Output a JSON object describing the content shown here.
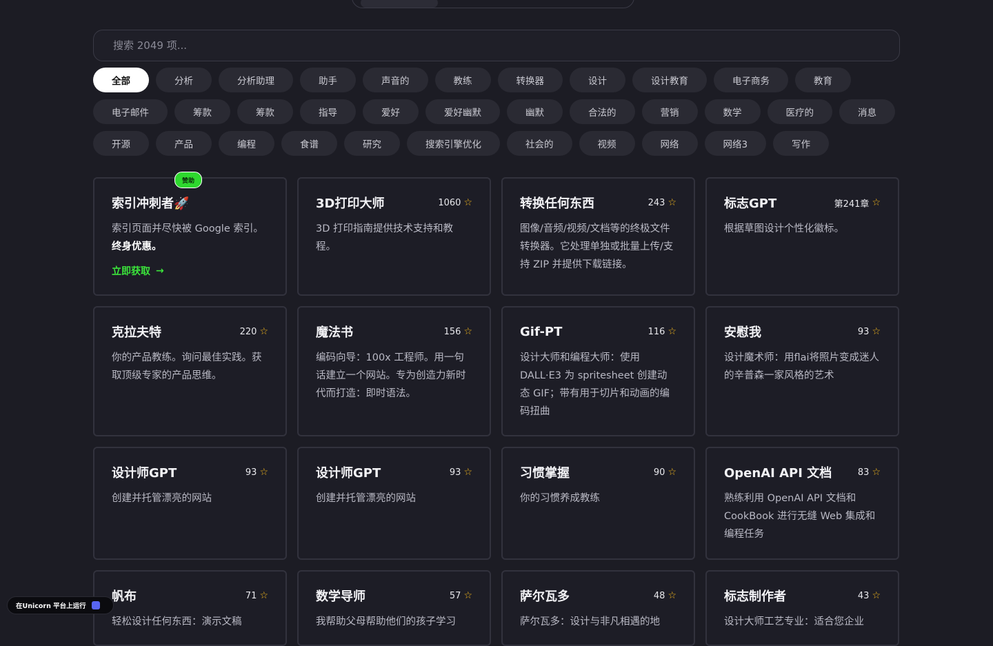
{
  "search": {
    "placeholder": "搜索 2049 项..."
  },
  "chips": {
    "rows": [
      [
        "全部",
        "分析",
        "分析助理",
        "助手",
        "声音的",
        "教练",
        "转换器",
        "设计",
        "设计教育",
        "电子商务",
        "教育"
      ],
      [
        "电子邮件",
        "筹款",
        "筹款",
        "指导",
        "爱好",
        "爱好幽默",
        "幽默",
        "合法的",
        "营销",
        "数学",
        "医疗的",
        "消息"
      ],
      [
        "开源",
        "产品",
        "编程",
        "食谱",
        "研究",
        "搜索引擎优化",
        "社会的",
        "视频",
        "网络",
        "网络3",
        "写作"
      ]
    ],
    "active": "全部"
  },
  "sponsor": {
    "badge": "赞助",
    "title": "索引冲刺者🚀",
    "desc_plain": "索引页面并尽快被 Google 索引。",
    "desc_bold": "终身优惠。",
    "cta": "立即获取",
    "cta_arrow": "→"
  },
  "cards": [
    {
      "title": "3D打印大师",
      "count": "1060",
      "desc": "3D 打印指南提供技术支持和教程。"
    },
    {
      "title": "转换任何东西",
      "count": "243",
      "desc": "图像/音频/视频/文档等的终极文件转换器。它处理单独或批量上传/支持 ZIP 并提供下载链接。"
    },
    {
      "title": "标志GPT",
      "count": "第241章",
      "desc": "根据草图设计个性化徽标。"
    },
    {
      "title": "克拉夫特",
      "count": "220",
      "desc": "你的产品教练。询问最佳实践。获取顶级专家的产品思维。"
    },
    {
      "title": "魔法书",
      "count": "156",
      "desc": "编码向导：100x 工程师。用一句话建立一个网站。专为创造力新时代而打造：即时语法。"
    },
    {
      "title": "Gif-PT",
      "count": "116",
      "desc": "设计大师和编程大师：使用 DALL·E3 为 spritesheet 创建动态 GIF；带有用于切片和动画的编码扭曲"
    },
    {
      "title": "安慰我",
      "count": "93",
      "desc": "设计魔术师：用flai将照片变成迷人的辛普森一家风格的艺术"
    },
    {
      "title": "设计师GPT",
      "count": "93",
      "desc": "创建并托管漂亮的网站"
    },
    {
      "title": "设计师GPT",
      "count": "93",
      "desc": "创建并托管漂亮的网站"
    },
    {
      "title": "习惯掌握",
      "count": "90",
      "desc": "你的习惯养成教练"
    },
    {
      "title": "OpenAI API 文档",
      "count": "83",
      "desc": "熟练利用 OpenAI API 文档和 CookBook 进行无缝 Web 集成和编程任务"
    },
    {
      "title": "帆布",
      "count": "71",
      "desc": "轻松设计任何东西：演示文稿"
    },
    {
      "title": "数学导师",
      "count": "57",
      "desc": "我帮助父母帮助他们的孩子学习"
    },
    {
      "title": "萨尔瓦多",
      "count": "48",
      "desc": "萨尔瓦多：设计与非凡相遇的地"
    },
    {
      "title": "标志制作者",
      "count": "43",
      "desc": "设计大师工艺专业：适合您企业"
    }
  ],
  "footer": {
    "text": "在Unicorn 平台上运行"
  },
  "colors": {
    "background": "#1c1c24",
    "accent_green": "#2ed82e",
    "star": "#f5b81c"
  },
  "icons": {
    "star": "star-icon",
    "arrow": "arrow-right-icon",
    "platform": "unicorn-logo-icon"
  }
}
